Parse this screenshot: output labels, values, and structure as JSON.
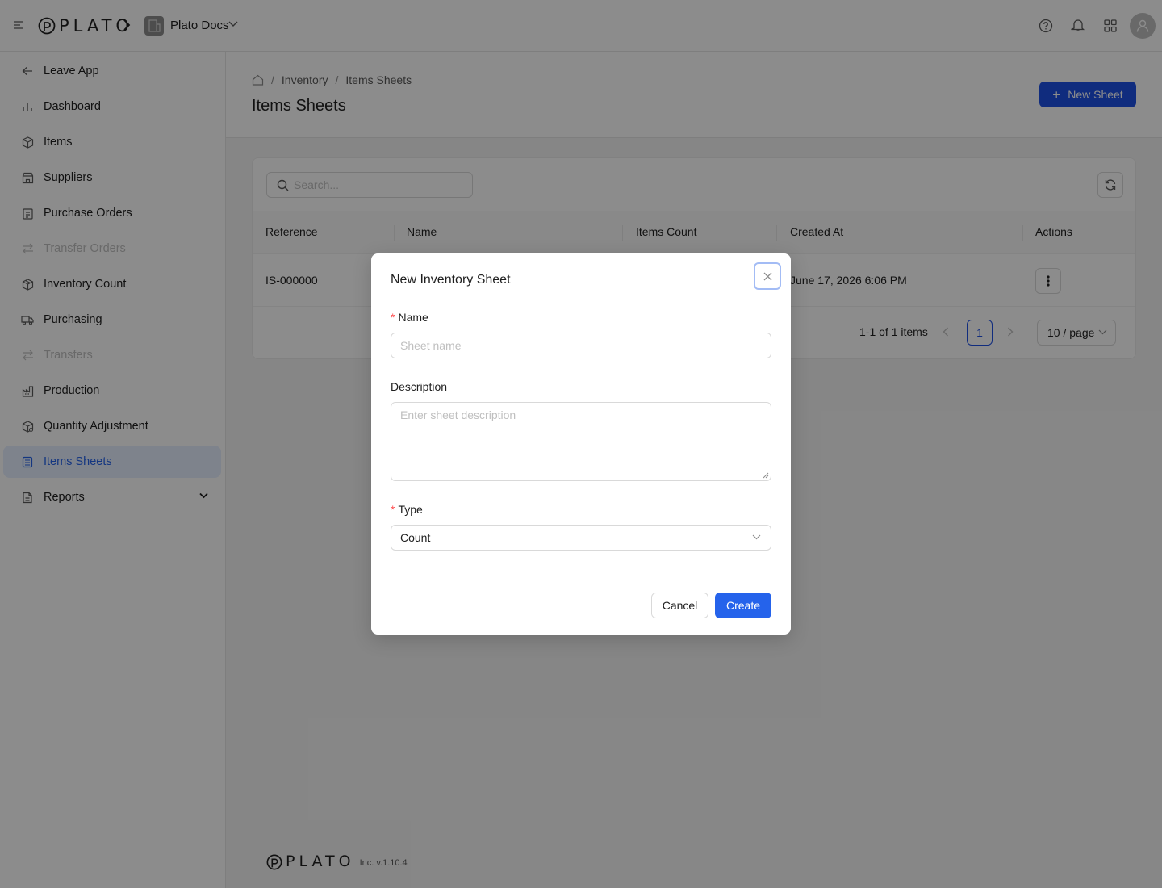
{
  "topbar": {
    "brand": "PLATO",
    "org_name": "Plato Docs",
    "icons": [
      "menu-icon",
      "chevron-right-icon",
      "building-icon",
      "chevron-down-icon",
      "help-icon",
      "bell-icon",
      "apps-icon",
      "user-icon"
    ]
  },
  "sidebar": {
    "items": [
      {
        "label": "Leave App",
        "icon": "arrow-left-icon",
        "state": "normal"
      },
      {
        "label": "Dashboard",
        "icon": "bar-chart-icon",
        "state": "normal"
      },
      {
        "label": "Items",
        "icon": "box-icon",
        "state": "normal"
      },
      {
        "label": "Suppliers",
        "icon": "store-icon",
        "state": "normal"
      },
      {
        "label": "Purchase Orders",
        "icon": "clipboard-icon",
        "state": "normal"
      },
      {
        "label": "Transfer Orders",
        "icon": "transfer-icon",
        "state": "disabled"
      },
      {
        "label": "Inventory Count",
        "icon": "boxes-icon",
        "state": "normal"
      },
      {
        "label": "Purchasing",
        "icon": "truck-icon",
        "state": "normal"
      },
      {
        "label": "Transfers",
        "icon": "transfer-icon",
        "state": "disabled"
      },
      {
        "label": "Production",
        "icon": "factory-icon",
        "state": "normal"
      },
      {
        "label": "Quantity Adjustment",
        "icon": "adjust-icon",
        "state": "normal"
      },
      {
        "label": "Items Sheets",
        "icon": "sheet-icon",
        "state": "active"
      },
      {
        "label": "Reports",
        "icon": "report-icon",
        "state": "normal"
      }
    ]
  },
  "header": {
    "breadcrumb": [
      "Inventory",
      "Items Sheets"
    ],
    "sep": "/",
    "title": "Items Sheets",
    "new_button": "New Sheet"
  },
  "table": {
    "search_placeholder": "Search...",
    "columns": [
      "Reference",
      "Name",
      "Items Count",
      "Created At",
      "Actions"
    ],
    "rows": [
      {
        "reference": "IS-000000",
        "name": "",
        "items_count": "",
        "created_at": "June 17, 2026 6:06 PM"
      }
    ],
    "pagination": {
      "total": "1-1 of 1 items",
      "current_page": "1",
      "page_size": "10 / page"
    }
  },
  "footer": {
    "brand": "PLATO",
    "version": "Inc. v.1.10.4"
  },
  "modal": {
    "title": "New Inventory Sheet",
    "name_label": "Name",
    "name_placeholder": "Sheet name",
    "description_label": "Description",
    "description_placeholder": "Enter sheet description",
    "type_label": "Type",
    "type_value": "Count",
    "required_mark": "*",
    "cancel": "Cancel",
    "create": "Create"
  },
  "colors": {
    "primary": "#2563eb",
    "overlay": "rgba(0,0,0,0.45)",
    "required": "#ff4d4f"
  }
}
